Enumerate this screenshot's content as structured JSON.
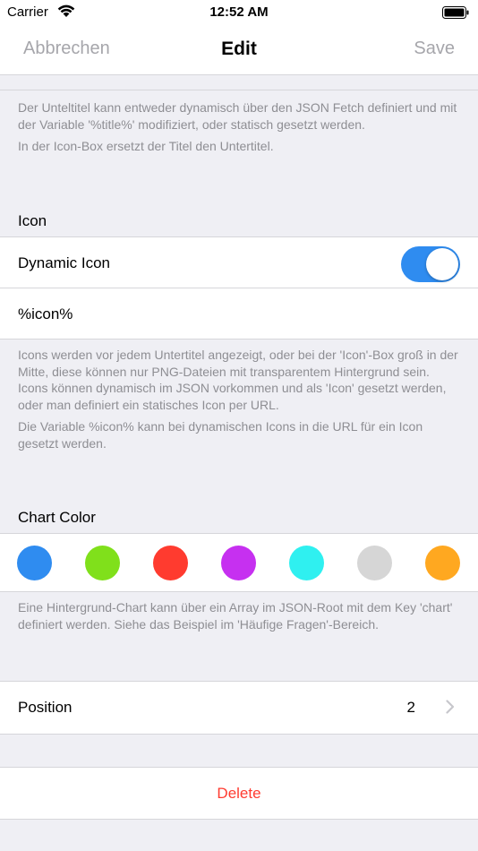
{
  "status_bar": {
    "carrier": "Carrier",
    "time": "12:52 AM"
  },
  "nav": {
    "cancel_label": "Abbrechen",
    "title": "Edit",
    "save_label": "Save"
  },
  "subtitle_footer": {
    "line1": "Der Unteltitel kann entweder dynamisch über den JSON Fetch definiert und mit der Variable '%title%' modifiziert, oder statisch gesetzt werden.",
    "line2": "In der Icon-Box ersetzt der Titel den Untertitel."
  },
  "icon_section": {
    "header": "Icon",
    "dynamic_icon_label": "Dynamic Icon",
    "dynamic_icon_on": true,
    "icon_value": "%icon%",
    "footer1": "Icons werden vor jedem Untertitel angezeigt, oder bei der 'Icon'-Box groß in der Mitte, diese können nur PNG-Dateien mit transparentem Hintergrund sein. Icons können dynamisch im JSON vorkommen und als 'Icon' gesetzt werden, oder man definiert ein statisches Icon per URL.",
    "footer2": "Die Variable %icon% kann bei dynamischen Icons in die URL für ein Icon gesetzt werden."
  },
  "chart_color_section": {
    "header": "Chart Color",
    "colors": [
      "#2f8cf0",
      "#80e01b",
      "#ff3b2f",
      "#c630f0",
      "#2ff0f0",
      "#d6d6d6",
      "#ffa820"
    ],
    "footer": "Eine Hintergrund-Chart kann über ein Array im JSON-Root mit dem Key 'chart' definiert werden. Siehe das Beispiel im 'Häufige Fragen'-Bereich."
  },
  "position": {
    "label": "Position",
    "value": "2"
  },
  "delete_label": "Delete",
  "colors": {
    "accent": "#2f8cf0",
    "destructive": "#ff3b30",
    "background": "#efeff4",
    "secondary_text": "#8e8e93"
  }
}
